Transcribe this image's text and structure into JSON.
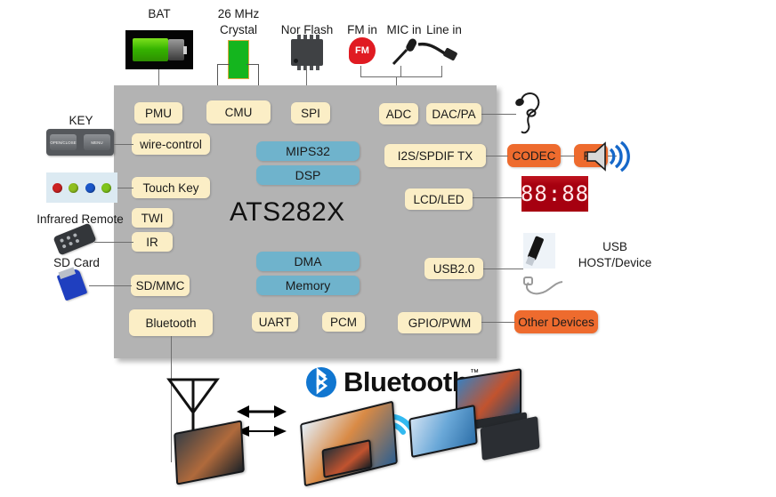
{
  "diagram": {
    "title": "ATS282X",
    "chip_label": "ATS282X"
  },
  "top_peripherals": [
    {
      "label": "BAT",
      "icon": "battery-icon"
    },
    {
      "label": "26 MHz\nCrystal",
      "line1": "26 MHz",
      "line2": "Crystal",
      "icon": "crystal-icon"
    },
    {
      "label": "Nor Flash",
      "icon": "flash-chip-icon"
    },
    {
      "label": "FM in",
      "icon": "fm-badge-icon"
    },
    {
      "label": "MIC in",
      "icon": "microphone-icon"
    },
    {
      "label": "Line in",
      "icon": "line-in-plug-icon"
    }
  ],
  "left_peripherals": [
    {
      "label": "KEY",
      "icon": "key-module-icon",
      "keys": [
        "OPEN/CLOSE",
        "MENU"
      ]
    },
    {
      "label": "",
      "icon": "touch-pad-icon",
      "dots": [
        "#cc2222",
        "#8fbf1f",
        "#1b57c9",
        "#7fc41b"
      ]
    },
    {
      "label": "Infrared Remote",
      "icon": "remote-control-icon"
    },
    {
      "label": "SD Card",
      "icon": "sd-card-icon"
    }
  ],
  "right_peripherals": [
    {
      "label": "",
      "icon": "earphone-icon"
    },
    {
      "label": "",
      "icon": "speaker-icon"
    },
    {
      "label": "",
      "icon": "seven-segment-display-icon",
      "value": "88:88"
    },
    {
      "label": "USB\nHOST/Device",
      "line1": "USB",
      "line2": "HOST/Device",
      "icon": "usb-stick-icon"
    }
  ],
  "chip_blocks_left": [
    {
      "id": "pmu",
      "label": "PMU"
    },
    {
      "id": "cmu",
      "label": "CMU"
    },
    {
      "id": "spi",
      "label": "SPI"
    },
    {
      "id": "wire-control",
      "label": "wire-control"
    },
    {
      "id": "touch-key",
      "label": "Touch Key"
    },
    {
      "id": "twi",
      "label": "TWI"
    },
    {
      "id": "ir",
      "label": "IR"
    },
    {
      "id": "sd-mmc",
      "label": "SD/MMC"
    },
    {
      "id": "bluetooth",
      "label": "Bluetooth"
    }
  ],
  "chip_blocks_core": [
    {
      "id": "mips32",
      "label": "MIPS32"
    },
    {
      "id": "dsp",
      "label": "DSP"
    },
    {
      "id": "dma",
      "label": "DMA"
    },
    {
      "id": "memory",
      "label": "Memory"
    }
  ],
  "chip_blocks_bottom": [
    {
      "id": "uart",
      "label": "UART"
    },
    {
      "id": "pcm",
      "label": "PCM"
    }
  ],
  "chip_blocks_right": [
    {
      "id": "adc",
      "label": "ADC"
    },
    {
      "id": "dac-pa",
      "label": "DAC/PA"
    },
    {
      "id": "i2s-spdif-tx",
      "label": "I2S/SPDIF TX"
    },
    {
      "id": "lcd-led",
      "label": "LCD/LED"
    },
    {
      "id": "usb2",
      "label": "USB2.0"
    },
    {
      "id": "gpio-pwm",
      "label": "GPIO/PWM"
    }
  ],
  "external_blocks": [
    {
      "id": "codec",
      "label": "CODEC"
    },
    {
      "id": "pa",
      "label": "PA"
    },
    {
      "id": "other-devices",
      "label": "Other Devices"
    }
  ],
  "bottom": {
    "bluetooth_word": "Bluetooth",
    "bluetooth_tm": "™"
  },
  "colors": {
    "chip_body": "#b3b3b3",
    "cream_block": "#fbeec6",
    "blue_block": "#6fb3cc",
    "orange_block": "#ee6b2e",
    "connector": "#6e6e6e",
    "bluetooth_blue": "#1176d0",
    "led_red": "#a60010"
  }
}
